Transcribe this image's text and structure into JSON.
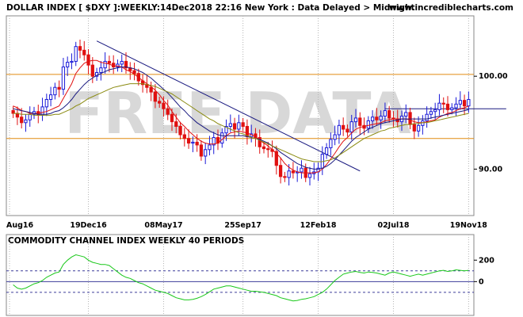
{
  "header": {
    "title": "DOLLAR INDEX [ $DXY ]:WEEKLY:14Dec2018 22:16 New York : Data Delayed > Midnight",
    "site": "www.incrediblecharts.com"
  },
  "watermark": "FREE DATA",
  "colors": {
    "price_up": "#1a1ad8",
    "price_down": "#e01010",
    "ma_short": "#e01010",
    "ma_mid": "#1a1a80",
    "ma_long": "#8a8a10",
    "support_lines": "#e08a10",
    "trendline": "#1a1a80",
    "cci_line": "#19c819",
    "cci_levels": "#3c3c9a",
    "grid": "#b4b4b4"
  },
  "chart_data": [
    {
      "type": "candlestick",
      "title": "DOLLAR INDEX [ $DXY ]:WEEKLY:14Dec2018 22:16 New York : Data Delayed > Midnight",
      "x_tick_labels": [
        "Aug16",
        "19Dec16",
        "08May17",
        "25Sep17",
        "12Feb18",
        "02Jul18",
        "19Nov18"
      ],
      "y_tick_labels": [
        "100.00",
        "90.00"
      ],
      "ylim": [
        85,
        106.5
      ],
      "horizontal_lines": [
        100.2,
        93.3
      ],
      "trendlines": [
        {
          "from": [
            20,
            103.8
          ],
          "to": [
            83,
            89.8
          ]
        },
        {
          "from": [
            89,
            96.5
          ],
          "to": [
            118,
            96.5
          ]
        }
      ],
      "series": [
        {
          "name": "close",
          "values": [
            96.0,
            95.6,
            95.0,
            95.3,
            95.9,
            96.2,
            95.8,
            96.7,
            97.5,
            98.0,
            98.8,
            98.6,
            101.0,
            101.5,
            101.6,
            103.2,
            102.8,
            102.3,
            101.2,
            100.0,
            100.4,
            100.9,
            101.6,
            101.4,
            101.0,
            101.3,
            101.6,
            100.9,
            100.6,
            100.3,
            99.5,
            99.1,
            98.8,
            98.3,
            97.3,
            97.1,
            96.5,
            95.9,
            95.1,
            94.6,
            93.7,
            93.3,
            92.8,
            92.9,
            92.6,
            91.4,
            92.1,
            92.6,
            93.4,
            92.8,
            93.9,
            94.6,
            94.9,
            94.3,
            95.0,
            94.6,
            93.5,
            93.8,
            93.4,
            92.4,
            92.2,
            92.1,
            91.9,
            90.4,
            89.2,
            89.1,
            89.8,
            89.6,
            89.7,
            90.1,
            89.1,
            89.5,
            89.7,
            90.1,
            91.6,
            92.3,
            93.2,
            93.7,
            94.7,
            94.3,
            94.0,
            95.1,
            95.5,
            94.7,
            94.4,
            95.2,
            95.6,
            95.3,
            95.7,
            96.3,
            95.5,
            95.4,
            95.1,
            95.7,
            96.1,
            94.8,
            94.1,
            94.7,
            95.2,
            95.9,
            96.2,
            96.4,
            97.1,
            97.0,
            96.4,
            96.6,
            97.0,
            97.4,
            96.8,
            97.5
          ]
        },
        {
          "name": "ma_short",
          "values": [
            96.8,
            96.6,
            96.3,
            96.2,
            96.0,
            96.0,
            96.0,
            96.1,
            96.2,
            96.4,
            96.6,
            96.8,
            97.6,
            98.4,
            99.2,
            100.3,
            100.9,
            101.4,
            101.6,
            101.7,
            101.7,
            101.5,
            101.4,
            101.3,
            101.1,
            101.1,
            101.0,
            100.7,
            100.5,
            100.2,
            99.9,
            99.5,
            99.2,
            98.9,
            98.5,
            98.0,
            97.4,
            96.9,
            96.2,
            95.6,
            95.0,
            94.6,
            94.1,
            93.7,
            93.3,
            93.0,
            92.8,
            92.7,
            92.7,
            92.8,
            93.2,
            93.6,
            93.9,
            94.0,
            94.1,
            94.0,
            93.9,
            93.7,
            93.5,
            93.1,
            92.8,
            92.5,
            92.1,
            91.7,
            91.2,
            90.6,
            90.2,
            89.9,
            89.7,
            89.6,
            89.6,
            89.6,
            89.6,
            89.7,
            90.0,
            90.5,
            91.1,
            91.7,
            92.4,
            93.0,
            93.4,
            93.9,
            94.3,
            94.5,
            94.6,
            94.7,
            94.8,
            94.9,
            95.0,
            95.2,
            95.3,
            95.4,
            95.4,
            95.4,
            95.4,
            95.3,
            95.1,
            95.0,
            95.0,
            95.1,
            95.2,
            95.3,
            95.6,
            95.8,
            96.0,
            96.1,
            96.3,
            96.5,
            96.6,
            96.8
          ]
        },
        {
          "name": "ma_mid",
          "values": [
            96.5,
            96.4,
            96.3,
            96.2,
            96.1,
            96.0,
            95.9,
            95.9,
            95.9,
            96.0,
            96.2,
            96.3,
            96.6,
            97.0,
            97.5,
            98.1,
            98.6,
            99.1,
            99.5,
            99.8,
            100.1,
            100.3,
            100.5,
            100.7,
            100.8,
            100.9,
            101.0,
            101.0,
            100.9,
            100.8,
            100.6,
            100.4,
            100.1,
            99.8,
            99.4,
            99.0,
            98.6,
            98.2,
            97.7,
            97.2,
            96.7,
            96.3,
            95.8,
            95.4,
            95.0,
            94.7,
            94.4,
            94.1,
            93.9,
            93.7,
            93.6,
            93.6,
            93.6,
            93.6,
            93.6,
            93.6,
            93.5,
            93.4,
            93.3,
            93.2,
            93.0,
            92.8,
            92.5,
            92.2,
            91.8,
            91.5,
            91.2,
            90.9,
            90.6,
            90.4,
            90.2,
            90.1,
            90.0,
            90.0,
            90.1,
            90.3,
            90.6,
            91.0,
            91.5,
            92.0,
            92.5,
            93.0,
            93.4,
            93.7,
            94.0,
            94.3,
            94.5,
            94.7,
            94.9,
            95.0,
            95.1,
            95.2,
            95.3,
            95.4,
            95.4,
            95.4,
            95.4,
            95.4,
            95.4,
            95.4,
            95.5,
            95.6,
            95.7,
            95.8,
            95.9,
            96.0,
            96.1,
            96.2,
            96.3,
            96.4
          ]
        },
        {
          "name": "ma_long",
          "values": [
            96.0,
            96.0,
            95.9,
            95.9,
            95.9,
            95.8,
            95.8,
            95.8,
            95.8,
            95.8,
            95.9,
            95.9,
            96.1,
            96.3,
            96.5,
            96.8,
            97.0,
            97.3,
            97.6,
            97.8,
            98.0,
            98.2,
            98.4,
            98.6,
            98.8,
            98.9,
            99.0,
            99.1,
            99.2,
            99.2,
            99.2,
            99.2,
            99.1,
            99.0,
            98.9,
            98.7,
            98.5,
            98.3,
            98.1,
            97.8,
            97.5,
            97.2,
            96.9,
            96.6,
            96.3,
            96.0,
            95.7,
            95.4,
            95.2,
            94.9,
            94.7,
            94.5,
            94.3,
            94.1,
            93.9,
            93.8,
            93.6,
            93.4,
            93.3,
            93.1,
            92.9,
            92.7,
            92.5,
            92.3,
            92.1,
            91.9,
            91.7,
            91.5,
            91.3,
            91.1,
            91.0,
            90.9,
            90.8,
            90.8,
            90.8,
            90.9,
            91.0,
            91.2,
            91.5,
            91.8,
            92.1,
            92.4,
            92.7,
            93.0,
            93.3,
            93.5,
            93.7,
            93.9,
            94.1,
            94.2,
            94.4,
            94.5,
            94.6,
            94.7,
            94.8,
            94.8,
            94.9,
            94.9,
            95.0,
            95.0,
            95.1,
            95.2,
            95.3,
            95.4,
            95.5,
            95.6,
            95.7,
            95.8,
            95.9,
            96.0
          ]
        }
      ]
    },
    {
      "type": "line",
      "title": "COMMODITY CHANNEL INDEX WEEKLY 40 PERIODS",
      "y_tick_labels": [
        "200",
        "0"
      ],
      "levels": [
        100,
        0,
        -100
      ],
      "ylim": [
        -300,
        320
      ],
      "series": [
        {
          "name": "cci",
          "values": [
            -30,
            -60,
            -70,
            -60,
            -40,
            -20,
            -10,
            10,
            40,
            60,
            80,
            90,
            160,
            200,
            230,
            250,
            240,
            230,
            200,
            180,
            170,
            160,
            160,
            150,
            120,
            90,
            60,
            40,
            30,
            10,
            -10,
            -20,
            -40,
            -60,
            -80,
            -90,
            -100,
            -110,
            -130,
            -150,
            -160,
            -170,
            -170,
            -165,
            -155,
            -140,
            -120,
            -95,
            -70,
            -60,
            -50,
            -40,
            -40,
            -50,
            -60,
            -70,
            -80,
            -90,
            -90,
            -95,
            -100,
            -110,
            -120,
            -130,
            -150,
            -160,
            -170,
            -180,
            -175,
            -165,
            -160,
            -150,
            -140,
            -120,
            -100,
            -70,
            -30,
            10,
            40,
            70,
            80,
            90,
            95,
            85,
            80,
            90,
            85,
            80,
            70,
            60,
            80,
            90,
            80,
            70,
            60,
            50,
            60,
            70,
            60,
            70,
            80,
            90,
            100,
            105,
            95,
            100,
            110,
            105,
            100,
            105
          ]
        }
      ]
    }
  ]
}
